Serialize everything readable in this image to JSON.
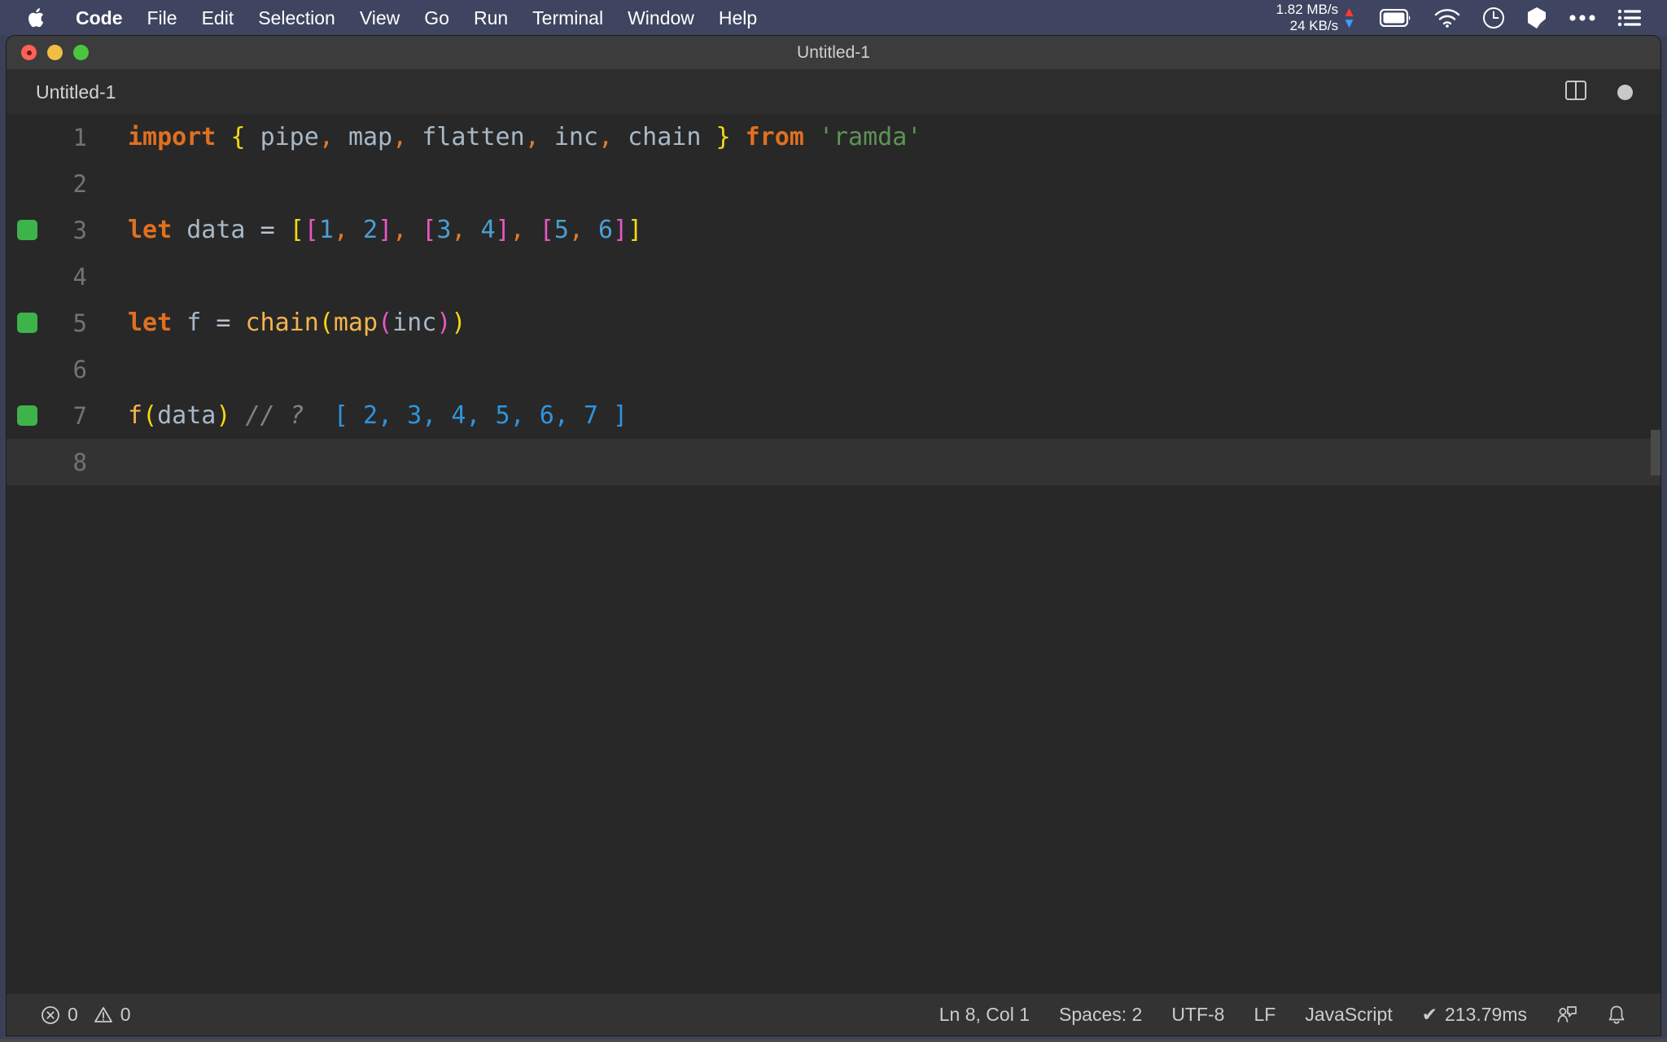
{
  "menubar": {
    "apple_icon": "apple-icon",
    "items": [
      {
        "label": "Code",
        "bold": true
      },
      {
        "label": "File",
        "bold": false
      },
      {
        "label": "Edit",
        "bold": false
      },
      {
        "label": "Selection",
        "bold": false
      },
      {
        "label": "View",
        "bold": false
      },
      {
        "label": "Go",
        "bold": false
      },
      {
        "label": "Run",
        "bold": false
      },
      {
        "label": "Terminal",
        "bold": false
      },
      {
        "label": "Window",
        "bold": false
      },
      {
        "label": "Help",
        "bold": false
      }
    ],
    "network": {
      "upload_rate": "1.82 MB/s",
      "download_rate": "24 KB/s",
      "up_arrow_color": "#ff3b30",
      "down_arrow_color": "#3aa0f5"
    },
    "tray_icons": [
      "battery-icon",
      "wifi-icon",
      "clock-icon",
      "dropbox-icon",
      "more-icon",
      "control-center-icon"
    ]
  },
  "window": {
    "title": "Untitled-1",
    "traffic_lights": [
      "close-button",
      "minimize-button",
      "zoom-button"
    ]
  },
  "tabbar": {
    "active_tab": "Untitled-1",
    "actions": [
      "split-editor-icon",
      "unsaved-indicator"
    ]
  },
  "editor": {
    "language": "JavaScript",
    "lines": [
      {
        "number": "1",
        "breakpoint": false,
        "current": false,
        "tokens": [
          {
            "text": "import",
            "style": "t-key"
          },
          {
            "text": " ",
            "style": "t-id"
          },
          {
            "text": "{",
            "style": "t-b1"
          },
          {
            "text": " ",
            "style": "t-id"
          },
          {
            "text": "pipe",
            "style": "t-id"
          },
          {
            "text": ",",
            "style": "t-punct"
          },
          {
            "text": " ",
            "style": "t-id"
          },
          {
            "text": "map",
            "style": "t-id"
          },
          {
            "text": ",",
            "style": "t-punct"
          },
          {
            "text": " ",
            "style": "t-id"
          },
          {
            "text": "flatten",
            "style": "t-id"
          },
          {
            "text": ",",
            "style": "t-punct"
          },
          {
            "text": " ",
            "style": "t-id"
          },
          {
            "text": "inc",
            "style": "t-id"
          },
          {
            "text": ",",
            "style": "t-punct"
          },
          {
            "text": " ",
            "style": "t-id"
          },
          {
            "text": "chain",
            "style": "t-id"
          },
          {
            "text": " ",
            "style": "t-id"
          },
          {
            "text": "}",
            "style": "t-b1"
          },
          {
            "text": " ",
            "style": "t-id"
          },
          {
            "text": "from",
            "style": "t-key"
          },
          {
            "text": " ",
            "style": "t-id"
          },
          {
            "text": "'ramda'",
            "style": "t-string"
          }
        ]
      },
      {
        "number": "2",
        "breakpoint": false,
        "current": false,
        "tokens": []
      },
      {
        "number": "3",
        "breakpoint": true,
        "current": false,
        "tokens": [
          {
            "text": "let",
            "style": "t-key"
          },
          {
            "text": " ",
            "style": "t-id"
          },
          {
            "text": "data",
            "style": "t-id"
          },
          {
            "text": " ",
            "style": "t-id"
          },
          {
            "text": "=",
            "style": "t-op"
          },
          {
            "text": " ",
            "style": "t-id"
          },
          {
            "text": "[",
            "style": "t-b1"
          },
          {
            "text": "[",
            "style": "t-b2"
          },
          {
            "text": "1",
            "style": "t-num"
          },
          {
            "text": ",",
            "style": "t-punct"
          },
          {
            "text": " ",
            "style": "t-id"
          },
          {
            "text": "2",
            "style": "t-num"
          },
          {
            "text": "]",
            "style": "t-b2"
          },
          {
            "text": ",",
            "style": "t-punct"
          },
          {
            "text": " ",
            "style": "t-id"
          },
          {
            "text": "[",
            "style": "t-b2"
          },
          {
            "text": "3",
            "style": "t-num"
          },
          {
            "text": ",",
            "style": "t-punct"
          },
          {
            "text": " ",
            "style": "t-id"
          },
          {
            "text": "4",
            "style": "t-num"
          },
          {
            "text": "]",
            "style": "t-b2"
          },
          {
            "text": ",",
            "style": "t-punct"
          },
          {
            "text": " ",
            "style": "t-id"
          },
          {
            "text": "[",
            "style": "t-b2"
          },
          {
            "text": "5",
            "style": "t-num"
          },
          {
            "text": ",",
            "style": "t-punct"
          },
          {
            "text": " ",
            "style": "t-id"
          },
          {
            "text": "6",
            "style": "t-num"
          },
          {
            "text": "]",
            "style": "t-b2"
          },
          {
            "text": "]",
            "style": "t-b1"
          }
        ]
      },
      {
        "number": "4",
        "breakpoint": false,
        "current": false,
        "tokens": []
      },
      {
        "number": "5",
        "breakpoint": true,
        "current": false,
        "tokens": [
          {
            "text": "let",
            "style": "t-key"
          },
          {
            "text": " ",
            "style": "t-id"
          },
          {
            "text": "f",
            "style": "t-id"
          },
          {
            "text": " ",
            "style": "t-id"
          },
          {
            "text": "=",
            "style": "t-op"
          },
          {
            "text": " ",
            "style": "t-id"
          },
          {
            "text": "chain",
            "style": "t-fn"
          },
          {
            "text": "(",
            "style": "t-b1"
          },
          {
            "text": "map",
            "style": "t-fn"
          },
          {
            "text": "(",
            "style": "t-b2"
          },
          {
            "text": "inc",
            "style": "t-id"
          },
          {
            "text": ")",
            "style": "t-b2"
          },
          {
            "text": ")",
            "style": "t-b1"
          }
        ]
      },
      {
        "number": "6",
        "breakpoint": false,
        "current": false,
        "tokens": []
      },
      {
        "number": "7",
        "breakpoint": true,
        "current": false,
        "tokens": [
          {
            "text": "f",
            "style": "t-fn"
          },
          {
            "text": "(",
            "style": "t-b1"
          },
          {
            "text": "data",
            "style": "t-id"
          },
          {
            "text": ")",
            "style": "t-b1"
          },
          {
            "text": " ",
            "style": "t-id"
          },
          {
            "text": "// ?",
            "style": "t-comment"
          },
          {
            "text": "  ",
            "style": "t-id"
          },
          {
            "text": "[ 2, 3, 4, 5, 6, 7 ]",
            "style": "t-inline"
          }
        ]
      },
      {
        "number": "8",
        "breakpoint": false,
        "current": true,
        "tokens": []
      }
    ]
  },
  "statusbar": {
    "errors": "0",
    "warnings": "0",
    "cursor": "Ln 8, Col 1",
    "indent": "Spaces: 2",
    "encoding": "UTF-8",
    "eol": "LF",
    "language": "JavaScript",
    "runtime": "213.79ms",
    "runtime_check": "✔",
    "feedback_icon": "feedback-icon",
    "bell_icon": "bell-icon"
  }
}
